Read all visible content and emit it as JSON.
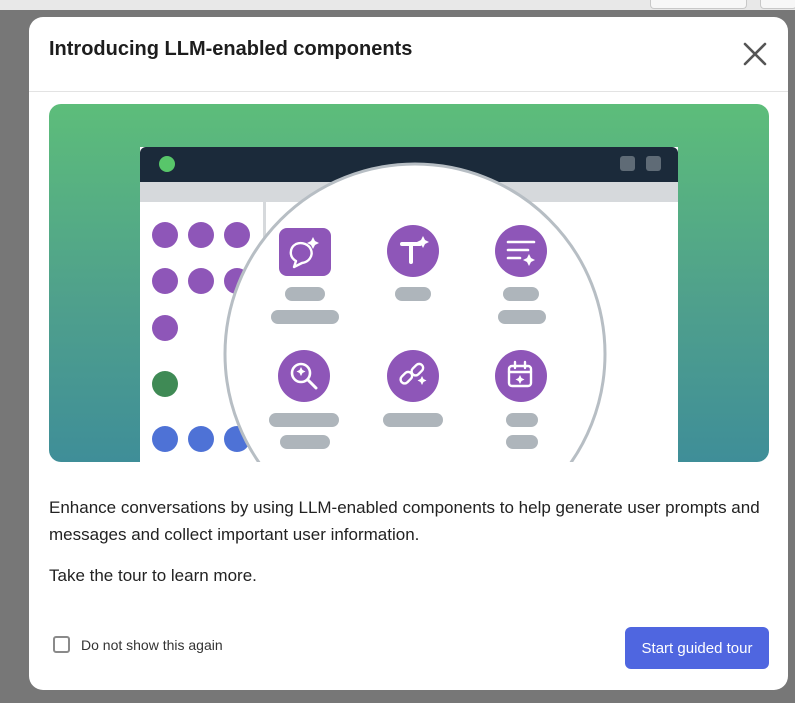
{
  "modal": {
    "title": "Introducing LLM-enabled components",
    "close_icon": "close-icon",
    "description": "Enhance conversations by using LLM-enabled components to help generate user prompts and messages and collect important user information.",
    "tour_prompt": "Take the tour to learn more.",
    "checkbox_label": "Do not show this again",
    "checkbox_checked": false,
    "start_button_label": "Start guided tour"
  },
  "illustration": {
    "icons": [
      "chat-sparkle-icon",
      "text-sparkle-icon",
      "list-sparkle-icon",
      "search-sparkle-icon",
      "link-sparkle-icon",
      "calendar-sparkle-icon"
    ]
  },
  "colors": {
    "primary_button": "#4f66e0",
    "accent_purple": "#8e56b8",
    "gradient_top": "#5dbd7a",
    "gradient_bottom": "#3f8e98",
    "window_bar": "#1b2a3a"
  }
}
